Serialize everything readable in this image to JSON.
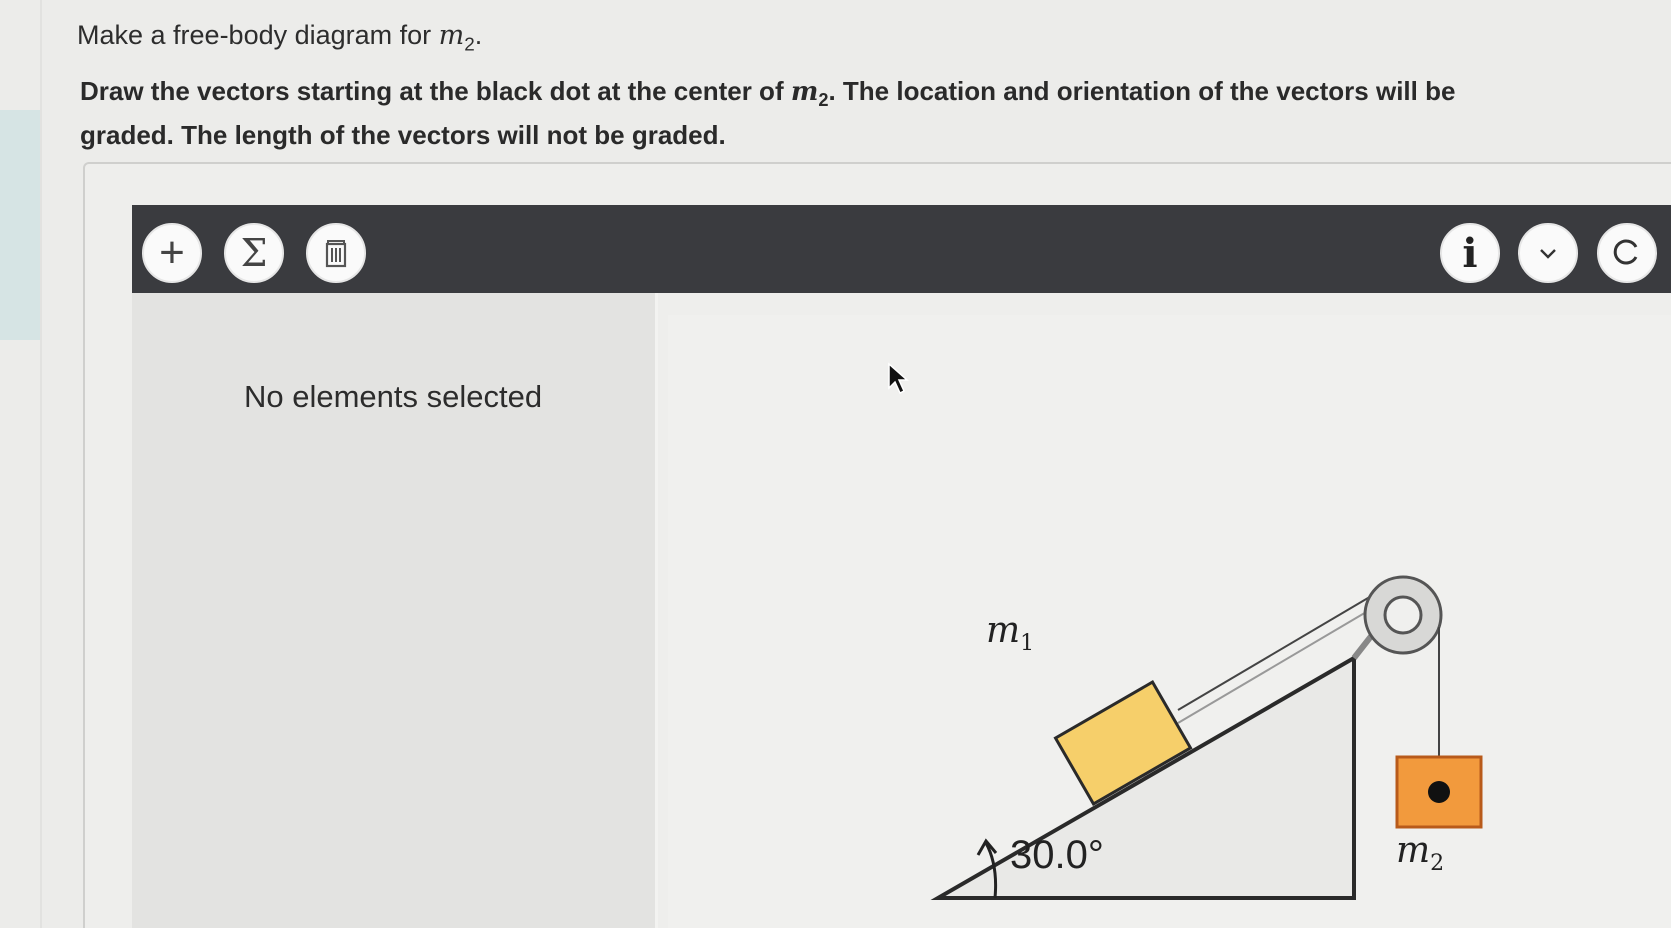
{
  "prompt": {
    "text_before": "Make a free-body diagram for ",
    "mass_symbol": "m",
    "mass_subscript": "2",
    "text_after": "."
  },
  "instruction": {
    "part1": "Draw the vectors starting at the black dot at the center of ",
    "mass_symbol": "m",
    "mass_subscript": "2",
    "part2": ". The location and orientation of the vectors will be graded. The length of the vectors will not be graded."
  },
  "toolbar": {
    "add_icon": "plus-icon",
    "sum_icon": "sigma-icon",
    "delete_icon": "trash-icon",
    "info_icon": "info-icon",
    "more_icon": "chevron-down-icon",
    "reset_icon": "reset-icon",
    "add_label": "+",
    "sum_label": "Σ",
    "info_label": "i"
  },
  "side_panel": {
    "status": "No elements selected"
  },
  "diagram": {
    "m1_symbol": "m",
    "m1_subscript": "1",
    "m2_symbol": "m",
    "m2_subscript": "2",
    "angle_label": "30.0°",
    "colors": {
      "block_m1": "#f6cf6a",
      "block_m2": "#f29a3d",
      "outline": "#2a2a2a"
    }
  }
}
